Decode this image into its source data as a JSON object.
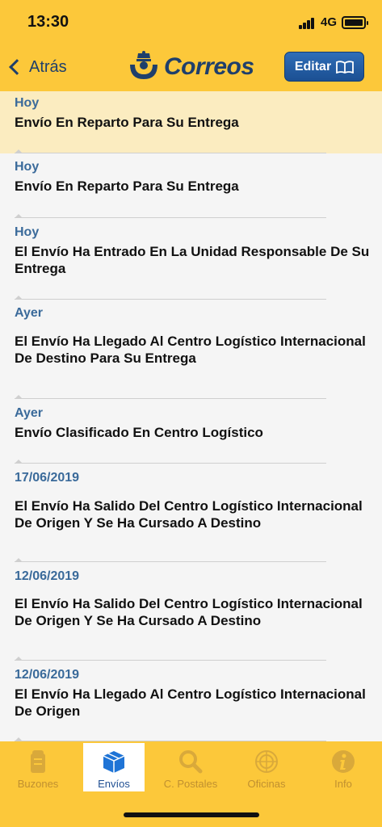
{
  "status_bar": {
    "time": "13:30",
    "network": "4G"
  },
  "nav": {
    "back_label": "Atrás",
    "logo_text": "Correos",
    "edit_label": "Editar"
  },
  "events": [
    {
      "date": "Hoy",
      "text": "Envío En Reparto Para Su Entrega",
      "highlighted": true
    },
    {
      "date": "Hoy",
      "text": "Envío En Reparto Para Su Entrega"
    },
    {
      "date": "Hoy",
      "text": "El Envío Ha Entrado En La Unidad Responsable De Su Entrega"
    },
    {
      "date": "Ayer",
      "text": "El Envío Ha Llegado Al Centro Logístico Internacional De Destino Para Su Entrega"
    },
    {
      "date": "Ayer",
      "text": "Envío Clasificado En Centro Logístico"
    },
    {
      "date": "17/06/2019",
      "text": "El Envío Ha Salido Del Centro Logístico Internacional De Origen  Y Se Ha Cursado A Destino"
    },
    {
      "date": "12/06/2019",
      "text": "El Envío Ha Salido Del Centro Logístico Internacional De Origen  Y Se Ha Cursado A Destino"
    },
    {
      "date": "12/06/2019",
      "text": "El Envío Ha Llegado Al Centro Logístico Internacional De Origen"
    }
  ],
  "tabs": [
    {
      "label": "Buzones",
      "icon": "mailbox-icon"
    },
    {
      "label": "Envíos",
      "icon": "package-icon",
      "active": true
    },
    {
      "label": "C. Postales",
      "icon": "magnifier-icon"
    },
    {
      "label": "Oficinas",
      "icon": "radar-icon"
    },
    {
      "label": "Info",
      "icon": "info-icon"
    }
  ],
  "colors": {
    "brand_yellow": "#fcc83a",
    "brand_blue": "#1f3f6b",
    "date_blue": "#3a6a9a",
    "highlight": "#fbecc0"
  }
}
